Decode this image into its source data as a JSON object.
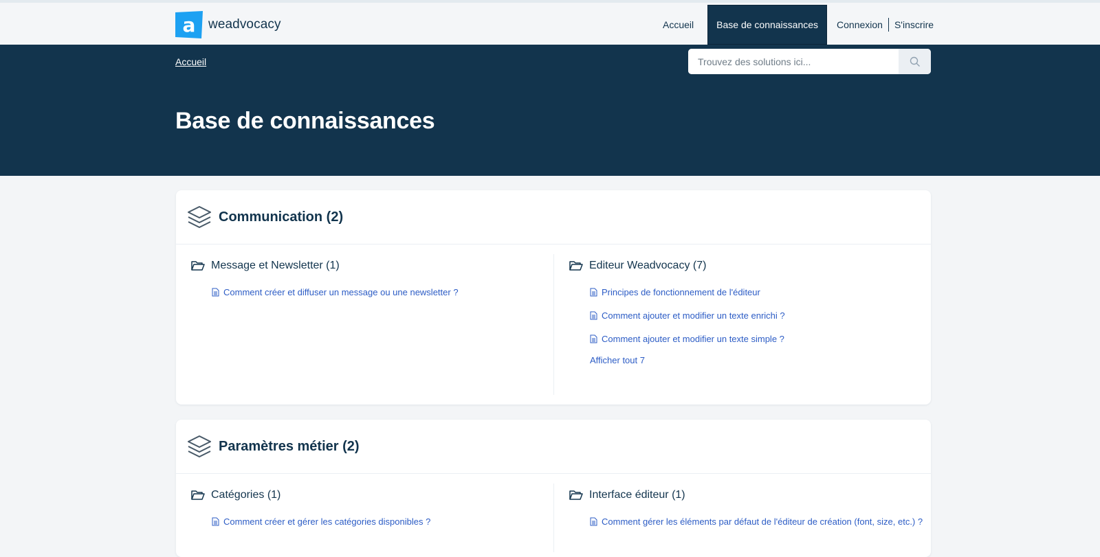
{
  "header": {
    "brand": "weadvocacy",
    "nav": {
      "home": "Accueil",
      "kb": "Base de connaissances",
      "login": "Connexion",
      "signup": "S'inscrire"
    }
  },
  "banner": {
    "breadcrumb": "Accueil",
    "search_placeholder": "Trouvez des solutions ici...",
    "title": "Base de connaissances"
  },
  "categories": [
    {
      "title": "Communication (2)",
      "folders": [
        {
          "title": "Message et Newsletter (1)",
          "articles": [
            "Comment créer et diffuser un message ou une newsletter ?"
          ]
        },
        {
          "title": "Editeur Weadvocacy (7)",
          "articles": [
            "Principes de fonctionnement de l'éditeur",
            "Comment ajouter et modifier un texte enrichi ?",
            "Comment ajouter et modifier un texte simple ?"
          ],
          "more": "Afficher tout 7"
        }
      ]
    },
    {
      "title": "Paramètres métier (2)",
      "folders": [
        {
          "title": "Catégories (1)",
          "articles": [
            "Comment créer et gérer les catégories disponibles ?"
          ]
        },
        {
          "title": "Interface éditeur (1)",
          "articles": [
            "Comment gérer les éléments par défaut de l'éditeur de création (font, size, etc.) ?"
          ]
        }
      ]
    }
  ],
  "colors": {
    "primary": "#12344d",
    "link": "#2c5cc5",
    "logo": "#1da1f2"
  }
}
